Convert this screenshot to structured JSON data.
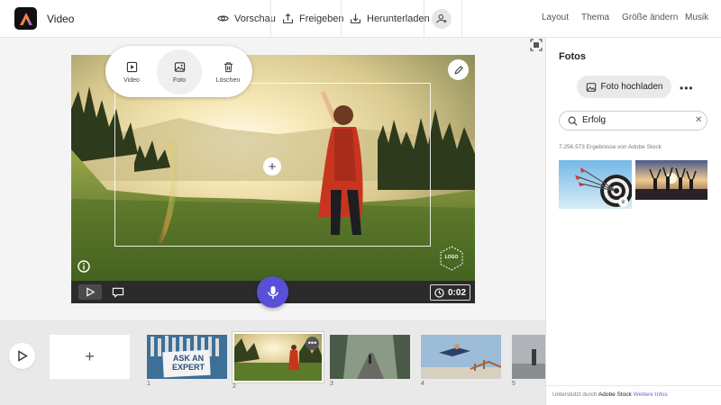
{
  "app": {
    "title": "Video"
  },
  "header": {
    "preview_label": "Vorschau",
    "share_label": "Freigeben",
    "download_label": "Herunterladen",
    "right_links": [
      "Layout",
      "Thema",
      "Größe ändern",
      "Musik"
    ]
  },
  "popup": {
    "items": [
      {
        "label": "Video",
        "icon": "video-icon"
      },
      {
        "label": "Foto",
        "icon": "photo-icon",
        "active": true
      },
      {
        "label": "Löschen",
        "icon": "trash-icon"
      }
    ]
  },
  "canvas": {
    "logo_placeholder": "LOGO",
    "duration": "0:02"
  },
  "timeline": {
    "scenes": [
      {
        "number": "1",
        "sign_text": "ASK AN EXPERT"
      },
      {
        "number": "2",
        "selected": true
      },
      {
        "number": "3"
      },
      {
        "number": "4"
      },
      {
        "number": "5"
      }
    ]
  },
  "panel": {
    "title": "Fotos",
    "upload_label": "Foto hochladen",
    "more": "•••",
    "search": {
      "value": "Erfolg",
      "placeholder": ""
    },
    "results_text": "7.256.573 Ergebnisse von Adobe Stock",
    "footer": {
      "prefix": "Unterstützt durch",
      "brand": "Adobe Stock",
      "link": "Weitere Infos"
    }
  },
  "colors": {
    "accent": "#5a50d8",
    "control_bar": "#2b2b2b"
  }
}
